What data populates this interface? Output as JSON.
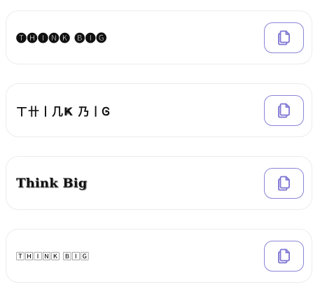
{
  "accent_color": "#7d74d2",
  "results": [
    {
      "text": "🅣🅗🅘🅝🅚 🅑🅘🅖",
      "copy_icon": "copy-icon"
    },
    {
      "text": "ㄒ卄丨几Ҝ 乃丨Ꮆ",
      "copy_icon": "copy-icon"
    },
    {
      "text": "Think Big",
      "copy_icon": "copy-icon"
    },
    {
      "text": "🅃🄷🄸🄽🄺 🄱🄸🄶",
      "copy_icon": "copy-icon"
    }
  ]
}
